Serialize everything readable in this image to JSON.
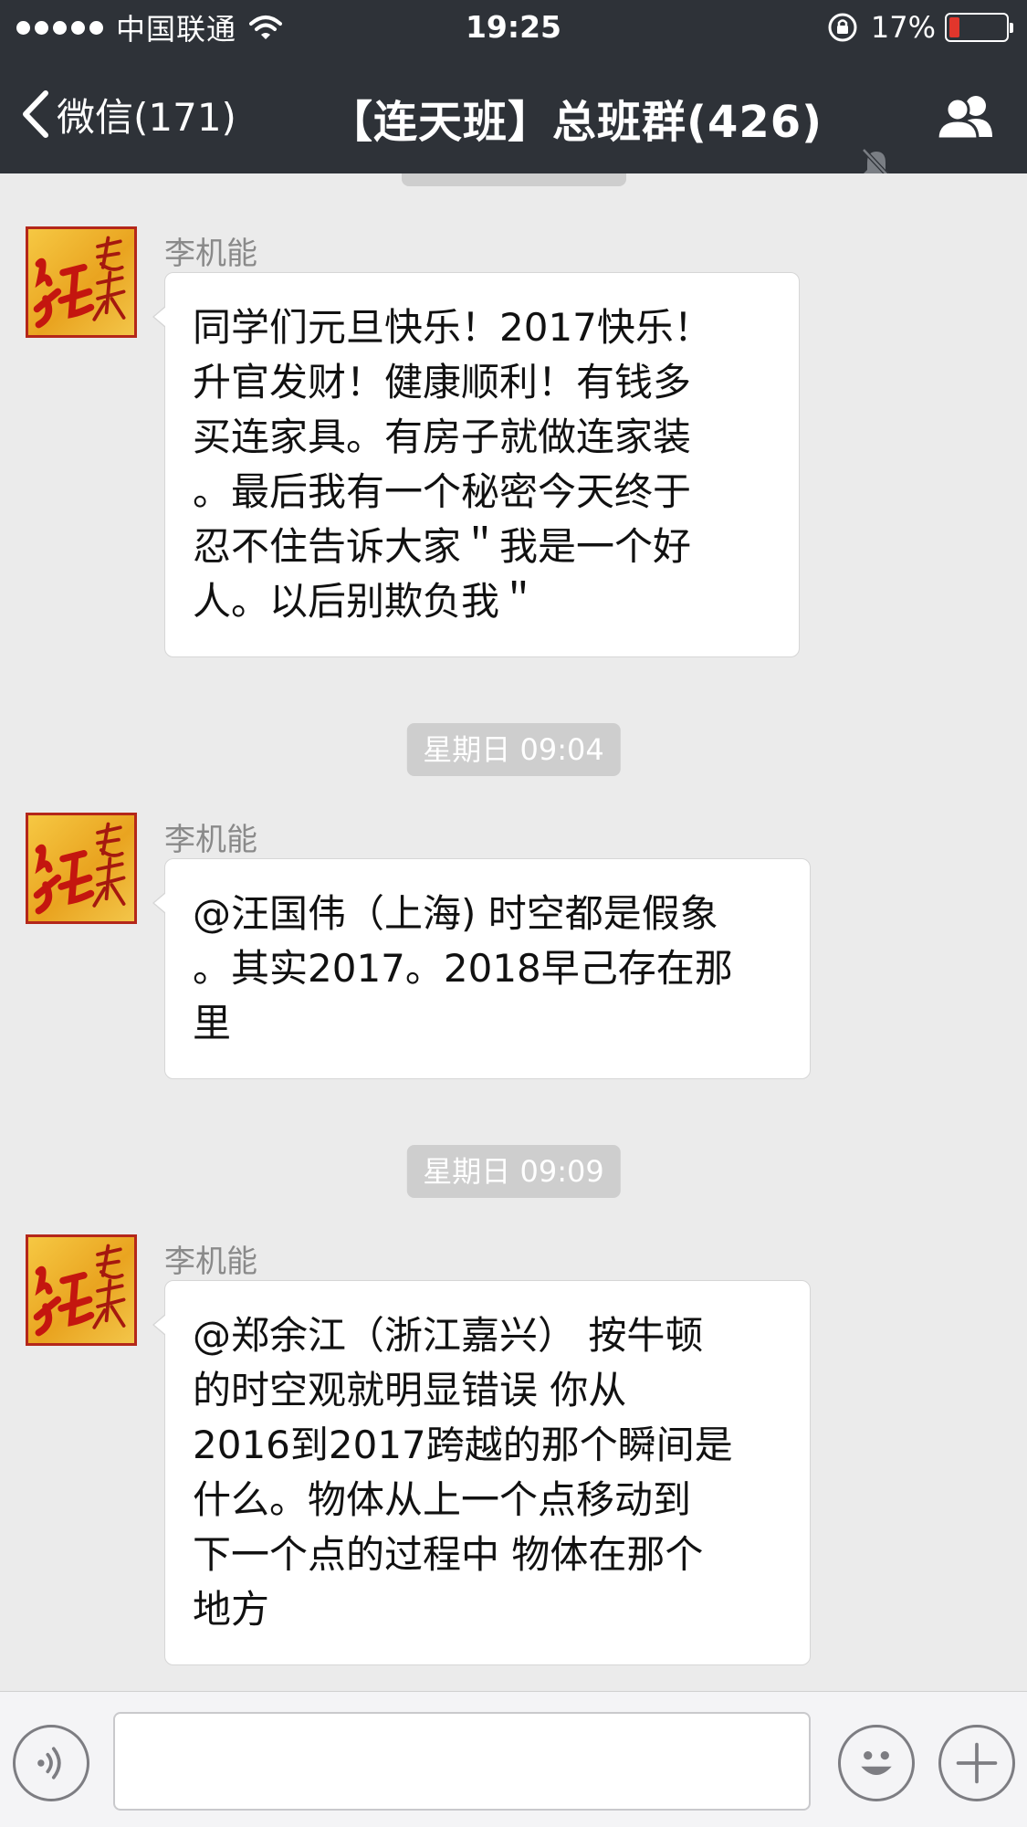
{
  "status_bar": {
    "carrier": "中国联通",
    "time": "19:25",
    "battery_percent_label": "17%",
    "battery_level": 0.17,
    "signal_bars": 5
  },
  "nav": {
    "back_label": "微信(171)",
    "title": "【连天班】总班群(426)",
    "muted": true
  },
  "chat": {
    "top_time_chip": "",
    "messages": [
      {
        "sender": "李机能",
        "lines": [
          "同学们元旦快乐！2017快乐！",
          "升官发财！健康顺利！有钱多",
          "买连家具。有房子就做连家装",
          "。最后我有一个秘密今天终于",
          "忍不住告诉大家＂我是一个好",
          "人。以后别欺负我＂"
        ]
      },
      {
        "time_chip": "星期日 09:04",
        "sender": "李机能",
        "lines": [
          "@汪国伟（上海) 时空都是假象",
          "。其实2017。2018早己存在那",
          "里"
        ]
      },
      {
        "time_chip": "星期日 09:09",
        "sender": "李机能",
        "lines": [
          "@郑余江（浙江嘉兴） 按牛顿",
          "的时空观就明显错误  你从",
          "2016到2017跨越的那个瞬间是",
          "什么。物体从上一个点移动到",
          "下一个点的过程中 物体在那个",
          "地方"
        ]
      }
    ]
  },
  "input_bar": {
    "text_value": "",
    "voice_icon": "voice-icon",
    "emoji_icon": "emoji-icon",
    "plus_icon": "plus-icon"
  },
  "colors": {
    "header_bg": "#2e3238",
    "chat_bg": "#ebebeb",
    "bubble_bg": "#ffffff",
    "time_chip_bg": "#cecece",
    "battery_low": "#e2362c"
  }
}
